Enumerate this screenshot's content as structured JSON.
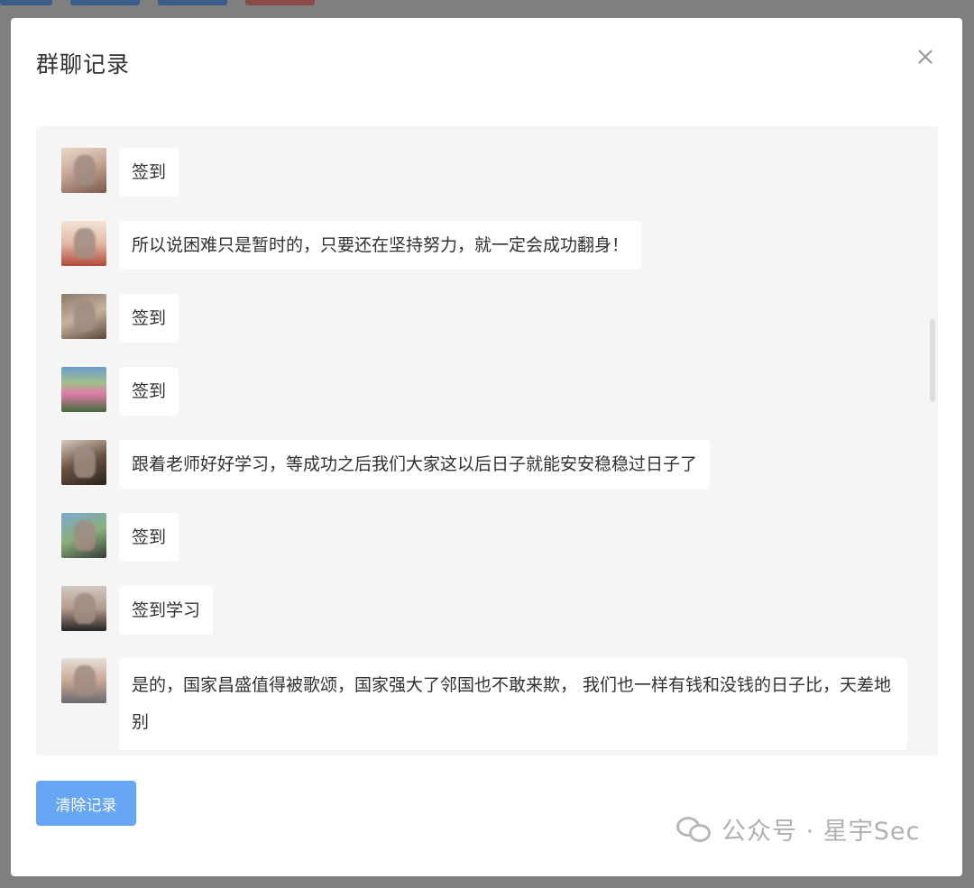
{
  "modal": {
    "title": "群聊记录",
    "close_label": "×"
  },
  "messages": [
    {
      "text": "签到",
      "avatar": "user-avatar-1"
    },
    {
      "text": "所以说困难只是暂时的，只要还在坚持努力，就一定会成功翻身！",
      "avatar": "user-avatar-2"
    },
    {
      "text": "签到",
      "avatar": "user-avatar-3"
    },
    {
      "text": "签到",
      "avatar": "user-avatar-4"
    },
    {
      "text": "跟着老师好好学习，等成功之后我们大家这以后日子就能安安稳稳过日子了",
      "avatar": "user-avatar-5"
    },
    {
      "text": "签到",
      "avatar": "user-avatar-6"
    },
    {
      "text": "签到学习",
      "avatar": "user-avatar-7"
    },
    {
      "text": "是的，国家昌盛值得被歌颂，国家强大了邻国也不敢来欺， 我们也一样有钱和没钱的日子比，天差地别",
      "avatar": "user-avatar-8"
    }
  ],
  "footer": {
    "clear_button_label": "清除记录"
  },
  "watermark": {
    "text": "公众号 · 星宇Sec",
    "icon": "wechat-icon"
  },
  "colors": {
    "primary_button": "#66a6f5",
    "chat_background": "#f5f5f5",
    "overlay": "#7f7f7f"
  }
}
